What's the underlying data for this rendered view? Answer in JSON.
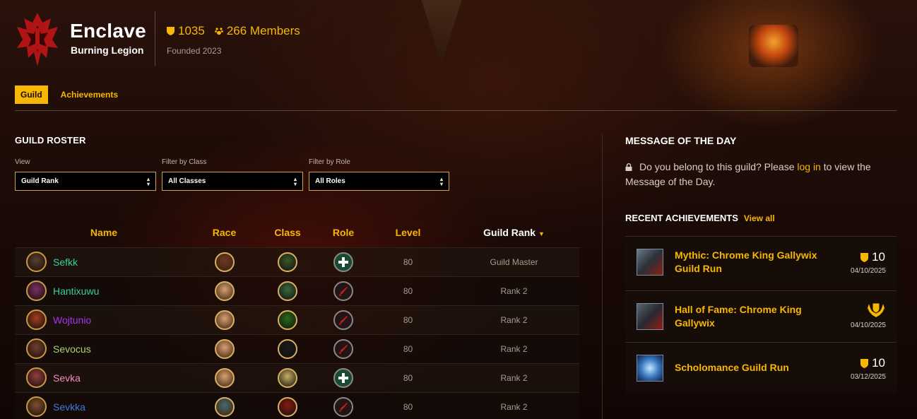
{
  "guild": {
    "name": "Enclave",
    "realm": "Burning Legion",
    "achievement_points": "1035",
    "members": "266 Members",
    "founded": "Founded 2023"
  },
  "tabs": [
    {
      "label": "Guild",
      "active": true
    },
    {
      "label": "Achievements",
      "active": false
    }
  ],
  "roster": {
    "title": "GUILD ROSTER",
    "filters": [
      {
        "label": "View",
        "value": "Guild Rank"
      },
      {
        "label": "Filter by Class",
        "value": "All Classes"
      },
      {
        "label": "Filter by Role",
        "value": "All Roles"
      }
    ],
    "columns": [
      "Name",
      "Race",
      "Class",
      "Role",
      "Level",
      "Guild Rank"
    ],
    "sort_icon": "caret-down-icon",
    "rows": [
      {
        "name": "Sefkk",
        "name_color": "#33d3a0",
        "level": "80",
        "rank": "Guild Master",
        "race_icon": "race-orc-icon",
        "class_icon": "class-shaman-icon",
        "role_icon": "role-healer-icon"
      },
      {
        "name": "Hantixuwu",
        "name_color": "#33d3a0",
        "level": "80",
        "rank": "Rank 2",
        "race_icon": "race-blood-elf-icon",
        "class_icon": "class-monk-icon",
        "role_icon": "role-damage-icon"
      },
      {
        "name": "Wojtunio",
        "name_color": "#a335ee",
        "level": "80",
        "rank": "Rank 2",
        "race_icon": "race-blood-elf-icon",
        "class_icon": "class-warlock-icon",
        "role_icon": "role-damage-icon"
      },
      {
        "name": "Sevocus",
        "name_color": "#abd473",
        "level": "80",
        "rank": "Rank 2",
        "race_icon": "race-blood-elf-icon",
        "class_icon": "class-hunter-icon",
        "role_icon": "role-damage-icon"
      },
      {
        "name": "Sevka",
        "name_color": "#f58cba",
        "level": "80",
        "rank": "Rank 2",
        "race_icon": "race-blood-elf-icon",
        "class_icon": "class-paladin-icon",
        "role_icon": "role-healer-icon"
      },
      {
        "name": "Sevkka",
        "name_color": "#3d7ae0",
        "level": "80",
        "rank": "Rank 2",
        "race_icon": "race-undead-icon",
        "class_icon": "class-priest-icon",
        "role_icon": "role-damage-icon"
      }
    ]
  },
  "motd": {
    "title": "MESSAGE OF THE DAY",
    "text_before": "Do you belong to this guild? Please ",
    "login_link": "log in",
    "text_after": " to view the Message of the Day."
  },
  "recent_achievements": {
    "title": "RECENT ACHIEVEMENTS",
    "view_all": "View all",
    "items": [
      {
        "name": "Mythic: Chrome King Gallywix Guild Run",
        "points": "10",
        "date": "04/10/2025",
        "badge": "shield-points-icon"
      },
      {
        "name": "Hall of Fame: Chrome King Gallywix",
        "points": "",
        "date": "04/10/2025",
        "badge": "feat-of-strength-icon"
      },
      {
        "name": "Scholomance Guild Run",
        "points": "10",
        "date": "03/12/2025",
        "badge": "shield-points-icon"
      }
    ]
  },
  "colors": {
    "accent": "#f8b700",
    "horde_red": "#b01414"
  }
}
